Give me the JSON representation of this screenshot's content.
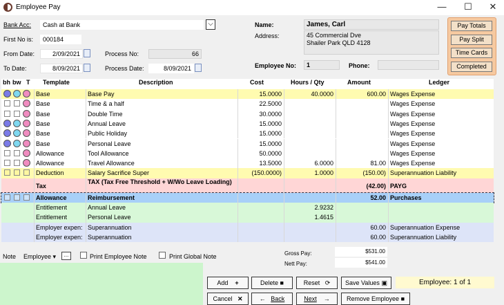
{
  "window": {
    "title": "Employee Pay",
    "controls": [
      "—",
      "☐",
      "✕"
    ]
  },
  "form": {
    "bank_acc_label": "Bank Acc:",
    "bank_acc_value": "Cash at Bank",
    "first_no_label": "First No is:",
    "first_no_value": "000184",
    "from_date_label": "From Date:",
    "from_date_value": "2/09/2021",
    "to_date_label": "To Date:",
    "to_date_value": "8/09/2021",
    "process_no_label": "Process No:",
    "process_no_value": "66",
    "process_date_label": "Process Date:",
    "process_date_value": "8/09/2021",
    "name_label": "Name:",
    "name_value": "James, Carl",
    "address_label": "Address:",
    "address_line1": "45 Commercial Dve",
    "address_line2": "Shailer Park QLD 4128",
    "employee_no_label": "Employee No:",
    "employee_no_value": "1",
    "phone_label": "Phone:",
    "phone_value": ""
  },
  "side_buttons": [
    "Pay Totals",
    "Pay Split",
    "Time Cards",
    "Completed"
  ],
  "grid": {
    "headers": {
      "bh": "bh",
      "bw": "bw",
      "t": "T",
      "template": "Template",
      "description": "Description",
      "cost": "Cost",
      "hours": "Hours / Qty",
      "amount": "Amount",
      "ledger": "Ledger"
    },
    "rows": [
      {
        "template": "Base",
        "description": "Base Pay",
        "cost": "15.0000",
        "hours": "40.0000",
        "amount": "600.00",
        "ledger": "Wages Expense",
        "bg": "#fffbb0",
        "marks": "circles",
        "bold": false
      },
      {
        "template": "Base",
        "description": "Time & a half",
        "cost": "22.5000",
        "hours": "",
        "amount": "",
        "ledger": "Wages Expense",
        "bg": "#ffffff",
        "marks": "squares-pink",
        "bold": false
      },
      {
        "template": "Base",
        "description": "Double Time",
        "cost": "30.0000",
        "hours": "",
        "amount": "",
        "ledger": "Wages Expense",
        "bg": "#ffffff",
        "marks": "squares-pink",
        "bold": false
      },
      {
        "template": "Base",
        "description": "Annual Leave",
        "cost": "15.0000",
        "hours": "",
        "amount": "",
        "ledger": "Wages Expense",
        "bg": "#ffffff",
        "marks": "circles",
        "bold": false
      },
      {
        "template": "Base",
        "description": "Public Holiday",
        "cost": "15.0000",
        "hours": "",
        "amount": "",
        "ledger": "Wages Expense",
        "bg": "#ffffff",
        "marks": "circles",
        "bold": false
      },
      {
        "template": "Base",
        "description": "Personal Leave",
        "cost": "15.0000",
        "hours": "",
        "amount": "",
        "ledger": "Wages Expense",
        "bg": "#ffffff",
        "marks": "circles",
        "bold": false
      },
      {
        "template": "Allowance",
        "description": "Tool Allowance",
        "cost": "50.0000",
        "hours": "",
        "amount": "",
        "ledger": "Wages Expense",
        "bg": "#ffffff",
        "marks": "squares-pink",
        "bold": false
      },
      {
        "template": "Allowance",
        "description": "Travel Allowance",
        "cost": "13.5000",
        "hours": "6.0000",
        "amount": "81.00",
        "ledger": "Wages Expense",
        "bg": "#ffffff",
        "marks": "squares-pink",
        "bold": false
      },
      {
        "template": "Deduction",
        "description": "Salary Sacrifice Super",
        "cost": "(150.0000)",
        "hours": "1.0000",
        "amount": "(150.00)",
        "ledger": "Superannuation Liability",
        "bg": "#fffbb0",
        "marks": "squares-yellow",
        "bold": false
      },
      {
        "template": "Tax",
        "description": "TAX (Tax Free Threshold  + W/Wo Leave Loading)",
        "cost": "",
        "hours": "",
        "amount": "(42.00)",
        "ledger": "PAYG",
        "bg": "#ffd6d6",
        "marks": "none",
        "bold": true,
        "tall": true
      },
      {
        "template": "Allowance",
        "description": "Reimbursement",
        "cost": "",
        "hours": "",
        "amount": "52.00",
        "ledger": "Purchases",
        "bg": "#a8d0f8",
        "marks": "squares-blue",
        "bold": true,
        "selected": true
      },
      {
        "template": "Entitlement",
        "description": "Annual Leave",
        "cost": "",
        "hours": "2.9232",
        "amount": "",
        "ledger": "",
        "bg": "#d8f8d8",
        "marks": "none",
        "bold": false
      },
      {
        "template": "Entitlement",
        "description": "Personal Leave",
        "cost": "",
        "hours": "1.4615",
        "amount": "",
        "ledger": "",
        "bg": "#d8f8d8",
        "marks": "none",
        "bold": false
      },
      {
        "template": "Employer expen:",
        "description": "Superannuation",
        "cost": "",
        "hours": "",
        "amount": "60.00",
        "ledger": "Superannuation Expense",
        "bg": "#dde4f8",
        "marks": "none",
        "bold": false
      },
      {
        "template": "Employer expen:",
        "description": "Superannuation",
        "cost": "",
        "hours": "",
        "amount": "60.00",
        "ledger": "Superannuation Liability",
        "bg": "#dde4f8",
        "marks": "none",
        "bold": false
      }
    ]
  },
  "note_bar": {
    "note_label": "Note",
    "note_type": "Employee",
    "ellipsis": "...",
    "print_employee_note": "Print Employee Note",
    "print_global_note": "Print Global Note"
  },
  "totals": {
    "gross_pay_label": "Gross Pay:",
    "gross_pay_value": "$531.00",
    "nett_pay_label": "Nett Pay:",
    "nett_pay_value": "$541.00"
  },
  "buttons": {
    "add": "Add",
    "delete": "Delete",
    "reset": "Reset",
    "save_values": "Save Values",
    "cancel": "Cancel",
    "back": "Back",
    "next": "Next",
    "remove_employee": "Remove Employee"
  },
  "status": {
    "record": "Employee: 1 of 1"
  },
  "colors": {
    "circle_blue": "#7a7ae8",
    "circle_cyan": "#7fd8f0",
    "circle_pink": "#f08cc0",
    "side_frame": "#f6c9a0"
  }
}
